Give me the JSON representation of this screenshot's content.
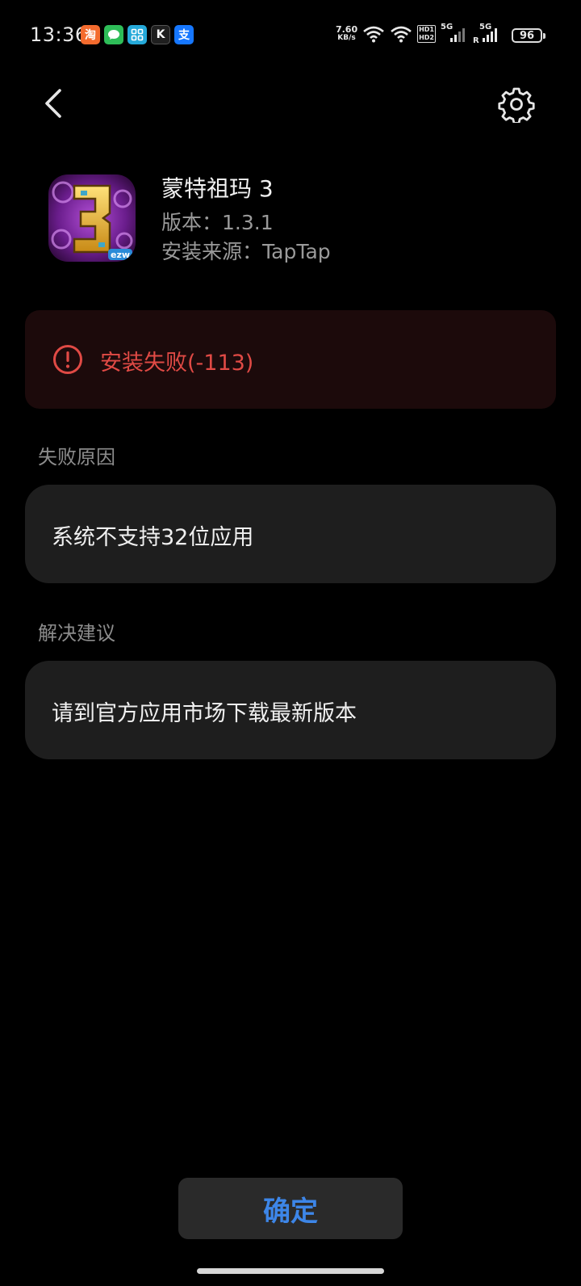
{
  "status_bar": {
    "time": "13:36",
    "notifications": [
      {
        "name": "taobao-icon",
        "glyph": "淘"
      },
      {
        "name": "wechat-icon",
        "glyph": ""
      },
      {
        "name": "app-grid-icon",
        "glyph": ""
      },
      {
        "name": "k-app-icon",
        "glyph": "K"
      },
      {
        "name": "alipay-icon",
        "glyph": "支"
      }
    ],
    "net_speed_value": "7.60",
    "net_speed_unit": "KB/s",
    "hd_top": "HD1",
    "hd_bottom": "HD2",
    "sim1_label": "5G",
    "sim2_label": "5G",
    "sim2_roaming": "R",
    "battery": "96"
  },
  "app": {
    "name": "蒙特祖玛 3",
    "version": "版本：1.3.1",
    "source": "安装来源：TapTap",
    "icon_badge": "ezw"
  },
  "error": {
    "message": "安装失败(-113)",
    "color": "#e04a45"
  },
  "failure_reason": {
    "label": "失败原因",
    "text": "系统不支持32位应用"
  },
  "solution": {
    "label": "解决建议",
    "text": "请到官方应用市场下载最新版本"
  },
  "confirm_button": {
    "label": "确定",
    "color": "#3d86e8"
  }
}
